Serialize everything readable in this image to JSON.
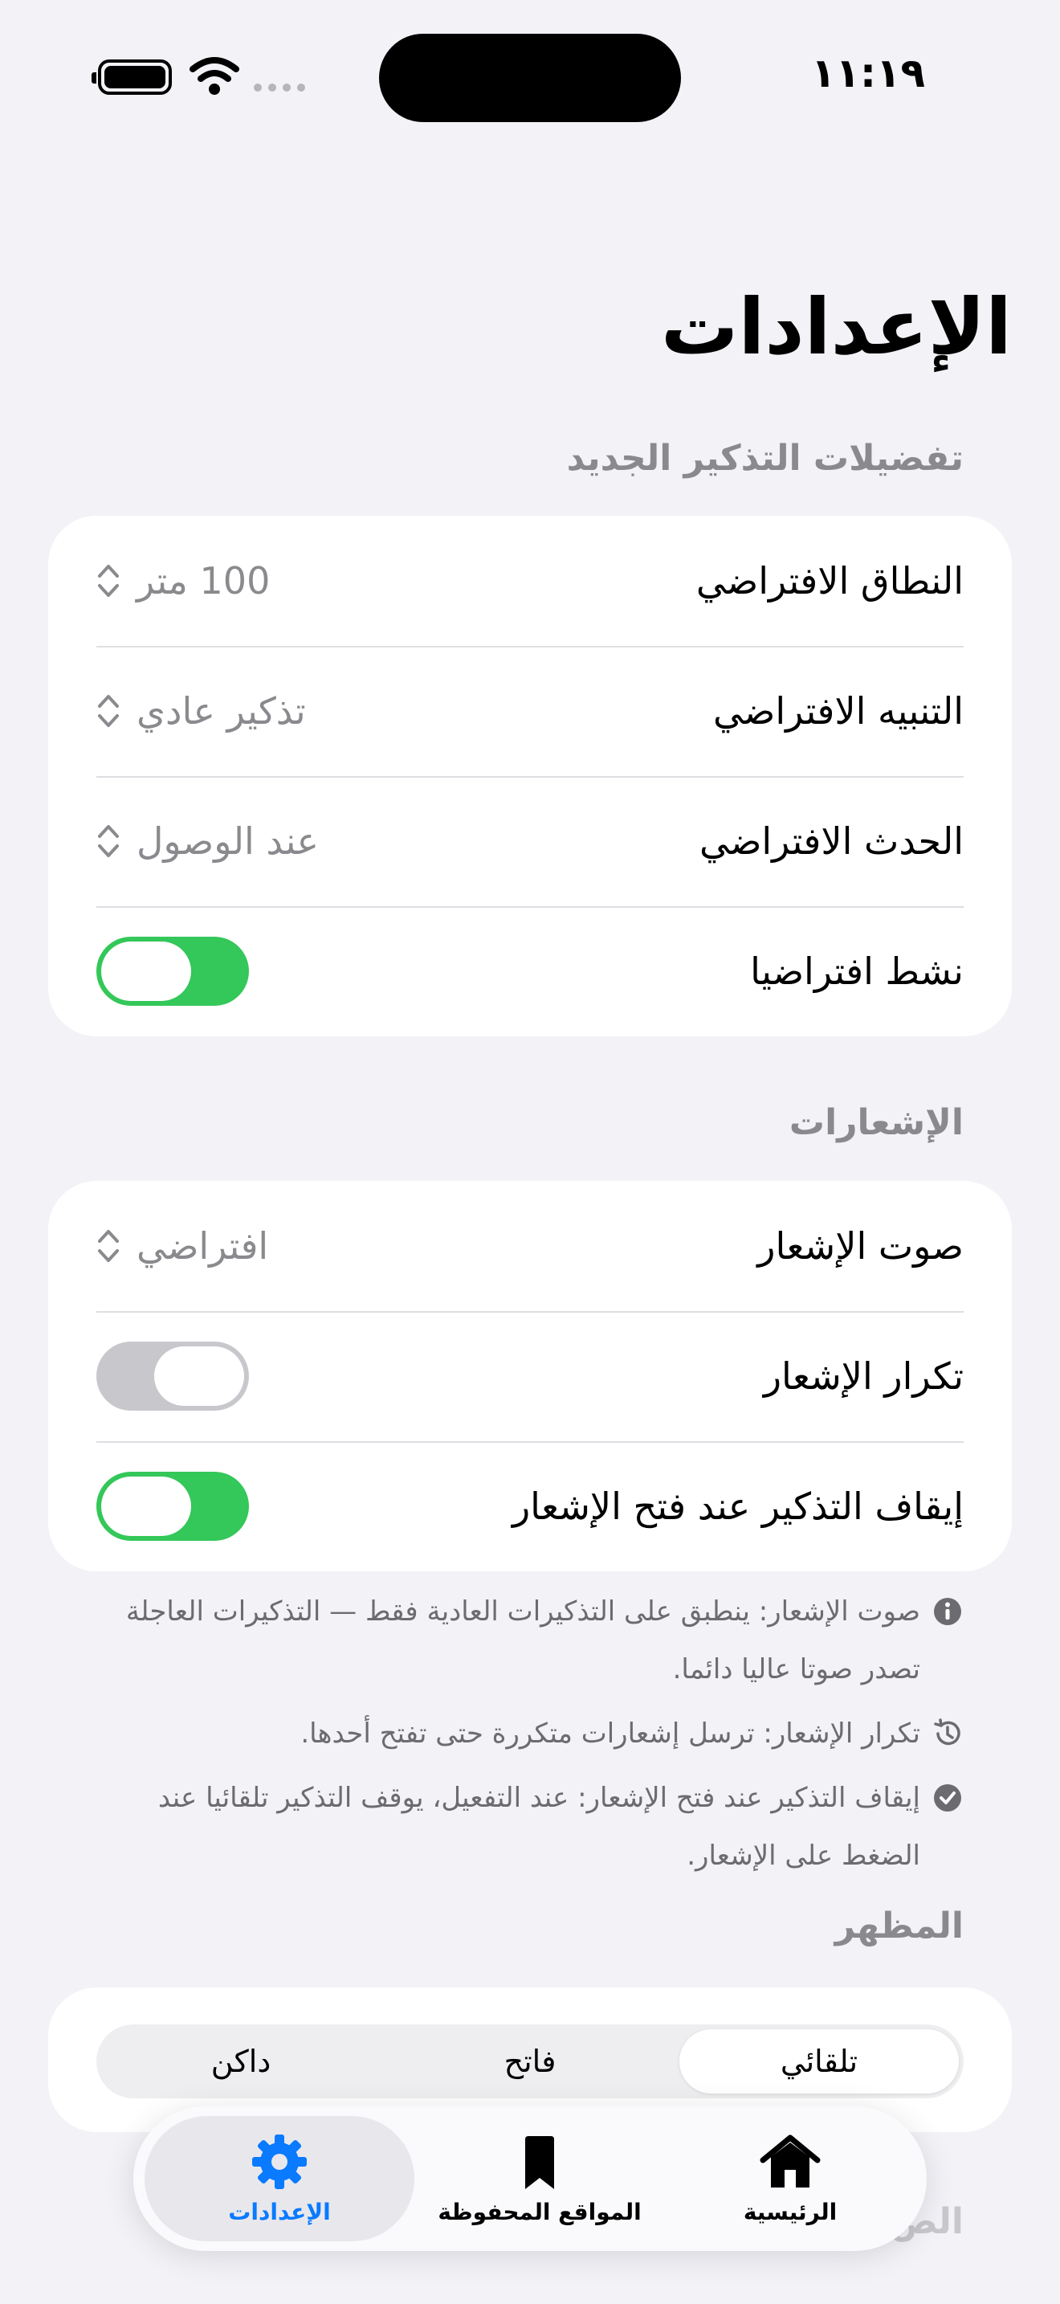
{
  "status_bar": {
    "time": "١١:١٩"
  },
  "page": {
    "title": "الإعدادات"
  },
  "sections": {
    "reminder_prefs": {
      "header": "تفضيلات التذكير الجديد",
      "rows": {
        "range": {
          "label": "النطاق الافتراضي",
          "value": "100 متر"
        },
        "alert": {
          "label": "التنبيه الافتراضي",
          "value": "تذكير عادي"
        },
        "event": {
          "label": "الحدث الافتراضي",
          "value": "عند الوصول"
        },
        "active": {
          "label": "نشط افتراضيا",
          "state": "on"
        }
      }
    },
    "notifications": {
      "header": "الإشعارات",
      "rows": {
        "sound": {
          "label": "صوت الإشعار",
          "value": "افتراضي"
        },
        "repeat": {
          "label": "تكرار الإشعار",
          "state": "off"
        },
        "stop_on_open": {
          "label": "إيقاف التذكير عند فتح الإشعار",
          "state": "on"
        }
      },
      "notes": [
        {
          "icon": "info-icon",
          "text": "صوت الإشعار: ينطبق على التذكيرات العادية فقط — التذكيرات العاجلة تصدر صوتا عاليا دائما."
        },
        {
          "icon": "history-icon",
          "text": "تكرار الإشعار: ترسل إشعارات متكررة حتى تفتح أحدها."
        },
        {
          "icon": "checkmark-circle-icon",
          "text": "إيقاف التذكير عند فتح الإشعار: عند التفعيل، يوقف التذكير تلقائيا عند الضغط على الإشعار."
        }
      ]
    },
    "appearance": {
      "header": "المظهر",
      "options": [
        "تلقائي",
        "فاتح",
        "داكن"
      ],
      "selected": "تلقائي"
    },
    "next": {
      "header": "الص"
    }
  },
  "tab_bar": {
    "home": "الرئيسية",
    "saved": "المواقع المحفوظة",
    "settings": "الإعدادات",
    "active": "settings",
    "active_color": "#0a7aff"
  },
  "colors": {
    "toggle_on": "#34c759",
    "toggle_off": "#c8c8cc",
    "background": "#f2f2f7"
  }
}
